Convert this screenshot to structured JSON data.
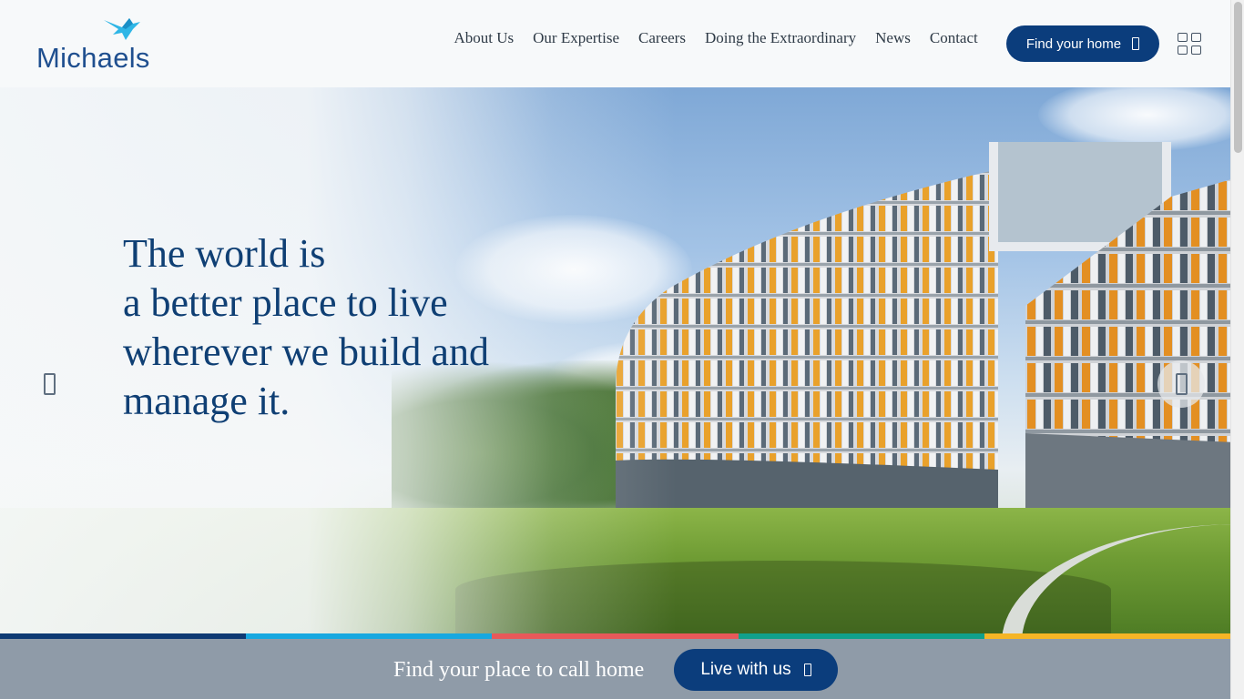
{
  "brand": {
    "name": "Michaels",
    "logo_icon": "bird-icon"
  },
  "nav": {
    "items": [
      "About Us",
      "Our Expertise",
      "Careers",
      "Doing the Extraordinary",
      "News",
      "Contact"
    ],
    "find_home_label": "Find your home",
    "menu_icon": "grid-menu-icon"
  },
  "hero": {
    "headline": [
      "The world is",
      "a better place to live",
      "wherever we build and",
      "manage it."
    ],
    "prev_icon": "chevron-left-icon",
    "next_icon": "chevron-right-icon"
  },
  "strip_colors": [
    "#0e3a73",
    "#17a8e0",
    "#e8595a",
    "#11a08b",
    "#f5b526"
  ],
  "cta": {
    "text": "Find your place to call home",
    "button_label": "Live with us"
  },
  "colors": {
    "primary": "#0b3d7c",
    "headline": "#0f3f74",
    "bar": "#8f9ba8"
  }
}
